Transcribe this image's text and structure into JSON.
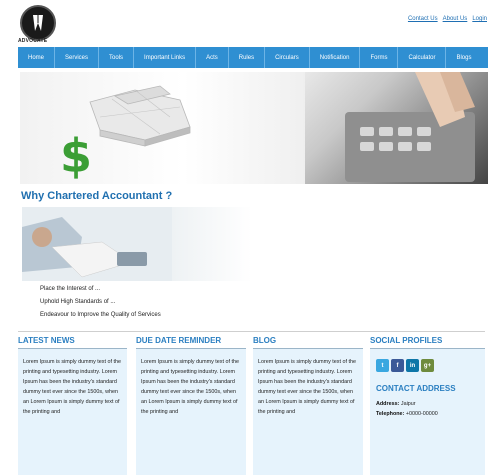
{
  "brand": {
    "logo_text": "ADVOCATE"
  },
  "top_links": [
    "Contact Us",
    "About Us",
    "Login"
  ],
  "nav": [
    "Home",
    "Services",
    "Tools",
    "Important Links",
    "Acts",
    "Rules",
    "Circulars",
    "Notification",
    "Forms",
    "Calculator",
    "Blogs"
  ],
  "intro": {
    "title": "Why Chartered Accountant ?",
    "points": [
      "Place the Interest of ...",
      "Uphold High Standards of ...",
      "Endeavour to Improve the Quality of Services"
    ]
  },
  "columns": [
    {
      "title": "LATEST NEWS",
      "text": "Lorem Ipsum is simply dummy text of the printing and typesetting industry. Lorem Ipsum has been the industry's standard dummy text ever since the 1500s, when an Lorem Ipsum is simply dummy text of the printing and"
    },
    {
      "title": "DUE DATE REMINDER",
      "text": "Lorem Ipsum is simply dummy text of the printing and typesetting industry. Lorem Ipsum has been the industry's standard dummy text ever since the 1500s, when an Lorem Ipsum is simply dummy text of the printing and"
    },
    {
      "title": "BLOG",
      "text": "Lorem Ipsum is simply dummy text of the printing and typesetting industry. Lorem Ipsum has been the industry's standard dummy text ever since the 1500s, when an Lorem Ipsum is simply dummy text of the printing and"
    }
  ],
  "social": {
    "title": "SOCIAL PROFILES",
    "icons": [
      {
        "name": "twitter-icon",
        "glyph": "t",
        "color": "#3aa7e0"
      },
      {
        "name": "facebook-icon",
        "glyph": "f",
        "color": "#3b5998"
      },
      {
        "name": "linkedin-icon",
        "glyph": "in",
        "color": "#0e76a8"
      },
      {
        "name": "googleplus-icon",
        "glyph": "g+",
        "color": "#6e8b3d"
      }
    ]
  },
  "contact": {
    "title": "CONTACT ADDRESS",
    "address_label": "Address:",
    "address_value": "Jaipur",
    "phone_label": "Telephone:",
    "phone_value": "+0000-00000"
  }
}
